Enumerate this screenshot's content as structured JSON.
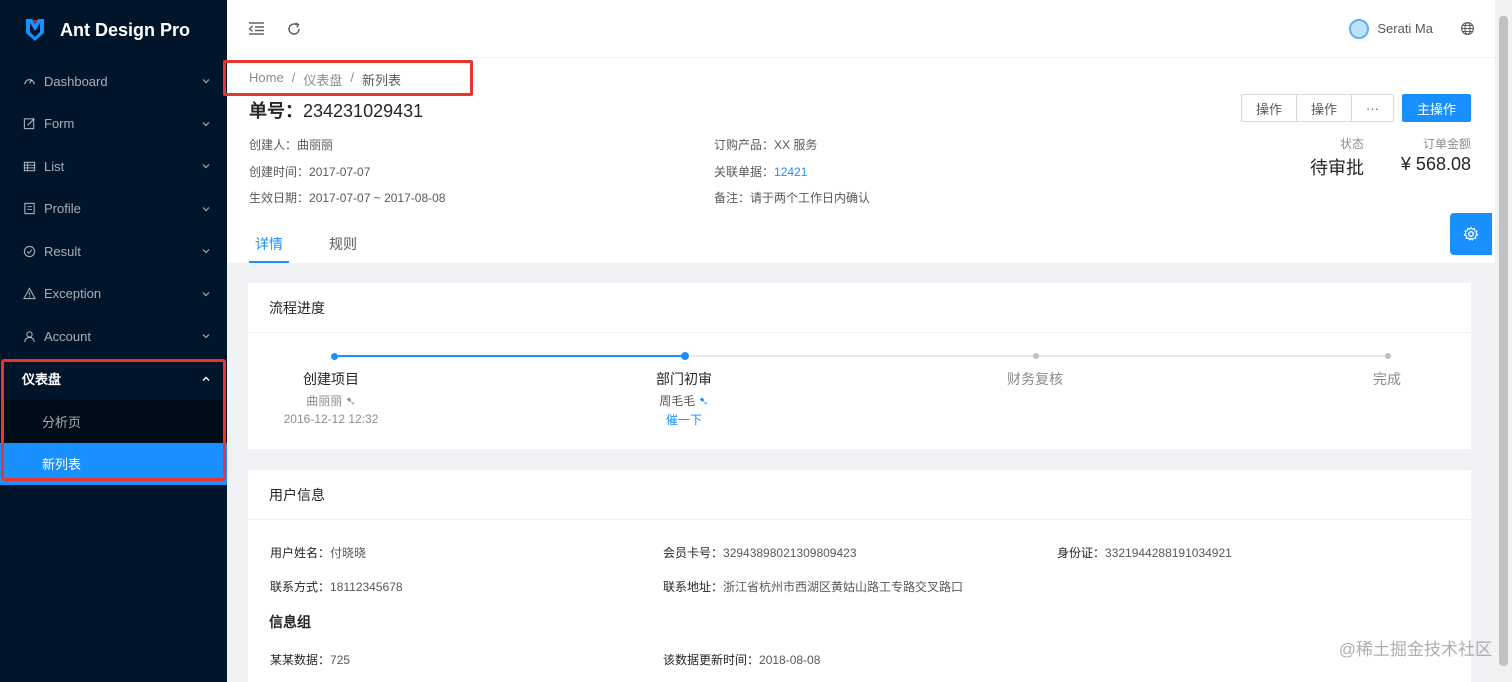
{
  "app": {
    "title": "Ant Design Pro"
  },
  "sidebar": {
    "items": [
      {
        "label": "Dashboard",
        "icon": "dashboard-icon"
      },
      {
        "label": "Form",
        "icon": "form-icon"
      },
      {
        "label": "List",
        "icon": "table-icon"
      },
      {
        "label": "Profile",
        "icon": "profile-icon"
      },
      {
        "label": "Result",
        "icon": "check-circle-icon"
      },
      {
        "label": "Exception",
        "icon": "warning-icon"
      },
      {
        "label": "Account",
        "icon": "user-icon"
      }
    ],
    "open_group": {
      "label": "仪表盘",
      "children": [
        "分析页",
        "新列表"
      ],
      "selected": "新列表"
    }
  },
  "header": {
    "username": "Serati Ma"
  },
  "breadcrumb": [
    "Home",
    "仪表盘",
    "新列表"
  ],
  "page": {
    "title_label": "单号：",
    "title_number": "234231029431",
    "actions": {
      "btn1": "操作",
      "btn2": "操作",
      "more": "···",
      "primary": "主操作"
    },
    "desc": {
      "creator_label": "创建人：",
      "creator": "曲丽丽",
      "product_label": "订购产品：",
      "product": "XX 服务",
      "created_label": "创建时间：",
      "created": "2017-07-07",
      "related_label": "关联单据：",
      "related": "12421",
      "valid_label": "生效日期：",
      "valid": "2017-07-07 ~ 2017-08-08",
      "remark_label": "备注：",
      "remark": "请于两个工作日内确认"
    },
    "stats": {
      "status_label": "状态",
      "status": "待审批",
      "amount_label": "订单金额",
      "amount": "¥ 568.08"
    },
    "tabs": [
      "详情",
      "规则"
    ]
  },
  "progress_card": {
    "title": "流程进度",
    "steps": [
      {
        "title": "创建项目",
        "sub": "曲丽丽",
        "time": "2016-12-12 12:32"
      },
      {
        "title": "部门初审",
        "sub": "周毛毛",
        "link": "催一下"
      },
      {
        "title": "财务复核"
      },
      {
        "title": "完成"
      }
    ]
  },
  "user_card": {
    "title": "用户信息",
    "name_label": "用户姓名：",
    "name": "付晓晓",
    "card_label": "会员卡号：",
    "card": "32943898021309809423",
    "id_label": "身份证：",
    "id": "3321944288191034921",
    "phone_label": "联系方式：",
    "phone": "18112345678",
    "addr_label": "联系地址：",
    "addr": "浙江省杭州市西湖区黄姑山路工专路交叉路口",
    "group_title": "信息组",
    "data_label": "某某数据：",
    "data": "725",
    "update_label": "该数据更新时间：",
    "update": "2018-08-08"
  },
  "watermark": "@稀土掘金技术社区",
  "colors": {
    "primary": "#1890ff",
    "sider": "#001529",
    "highlight": "#e8352d"
  }
}
